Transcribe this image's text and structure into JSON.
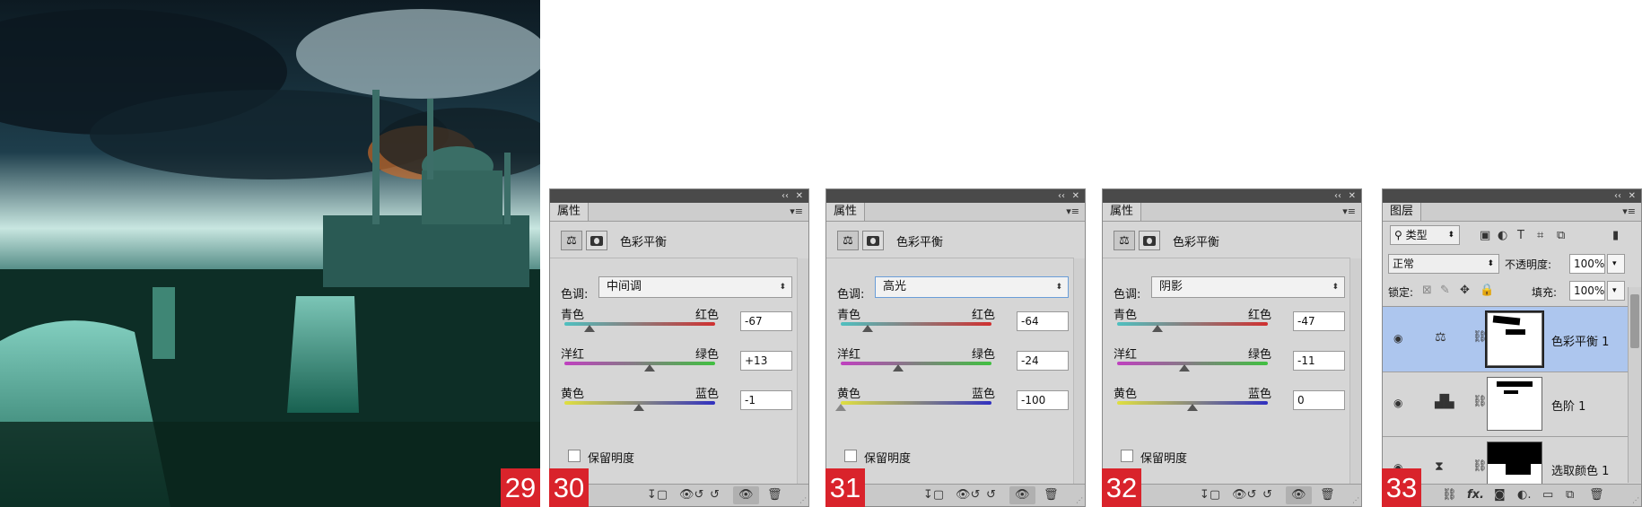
{
  "badges": [
    "29",
    "30",
    "31",
    "32",
    "33"
  ],
  "properties_panels": [
    {
      "tab": "属性",
      "adjustment_title": "色彩平衡",
      "tone_label": "色调:",
      "tone_value": "中间调",
      "sliders": [
        {
          "left": "青色",
          "right": "红色",
          "value": "-67",
          "amount": -67,
          "gradient": [
            "#4ec0c0",
            "#d03030"
          ]
        },
        {
          "left": "洋红",
          "right": "绿色",
          "value": "+13",
          "amount": 13,
          "gradient": [
            "#c040c0",
            "#40c040"
          ]
        },
        {
          "left": "黄色",
          "right": "蓝色",
          "value": "-1",
          "amount": -1,
          "gradient": [
            "#e0e040",
            "#3030c0"
          ]
        }
      ],
      "preserve_label": "保留明度"
    },
    {
      "tab": "属性",
      "adjustment_title": "色彩平衡",
      "tone_label": "色调:",
      "tone_value": "高光",
      "sliders": [
        {
          "left": "青色",
          "right": "红色",
          "value": "-64",
          "amount": -64,
          "gradient": [
            "#4ec0c0",
            "#d03030"
          ]
        },
        {
          "left": "洋红",
          "right": "绿色",
          "value": "-24",
          "amount": -24,
          "gradient": [
            "#c040c0",
            "#40c040"
          ]
        },
        {
          "left": "黄色",
          "right": "蓝色",
          "value": "-100",
          "amount": -100,
          "gradient": [
            "#e0e040",
            "#3030c0"
          ]
        }
      ],
      "preserve_label": "保留明度"
    },
    {
      "tab": "属性",
      "adjustment_title": "色彩平衡",
      "tone_label": "色调:",
      "tone_value": "阴影",
      "sliders": [
        {
          "left": "青色",
          "right": "红色",
          "value": "-47",
          "amount": -47,
          "gradient": [
            "#4ec0c0",
            "#d03030"
          ]
        },
        {
          "left": "洋红",
          "right": "绿色",
          "value": "-11",
          "amount": -11,
          "gradient": [
            "#c040c0",
            "#40c040"
          ]
        },
        {
          "left": "黄色",
          "right": "蓝色",
          "value": "0",
          "amount": 0,
          "gradient": [
            "#e0e040",
            "#3030c0"
          ]
        }
      ],
      "preserve_label": "保留明度"
    }
  ],
  "layers_panel": {
    "tab": "图层",
    "filter_kind": "类型",
    "blend_mode": "正常",
    "opacity_label": "不透明度:",
    "opacity_value": "100%",
    "lock_label": "锁定:",
    "fill_label": "填充:",
    "fill_value": "100%",
    "layers": [
      {
        "name": "色彩平衡 1",
        "selected": true,
        "icon": "balance-icon"
      },
      {
        "name": "色阶 1",
        "selected": false,
        "icon": "levels-icon"
      },
      {
        "name": "选取颜色 1",
        "selected": false,
        "icon": "selective-color-icon"
      }
    ]
  },
  "colors": {
    "badge": "#d9232b",
    "selection": "#adc6ee"
  }
}
